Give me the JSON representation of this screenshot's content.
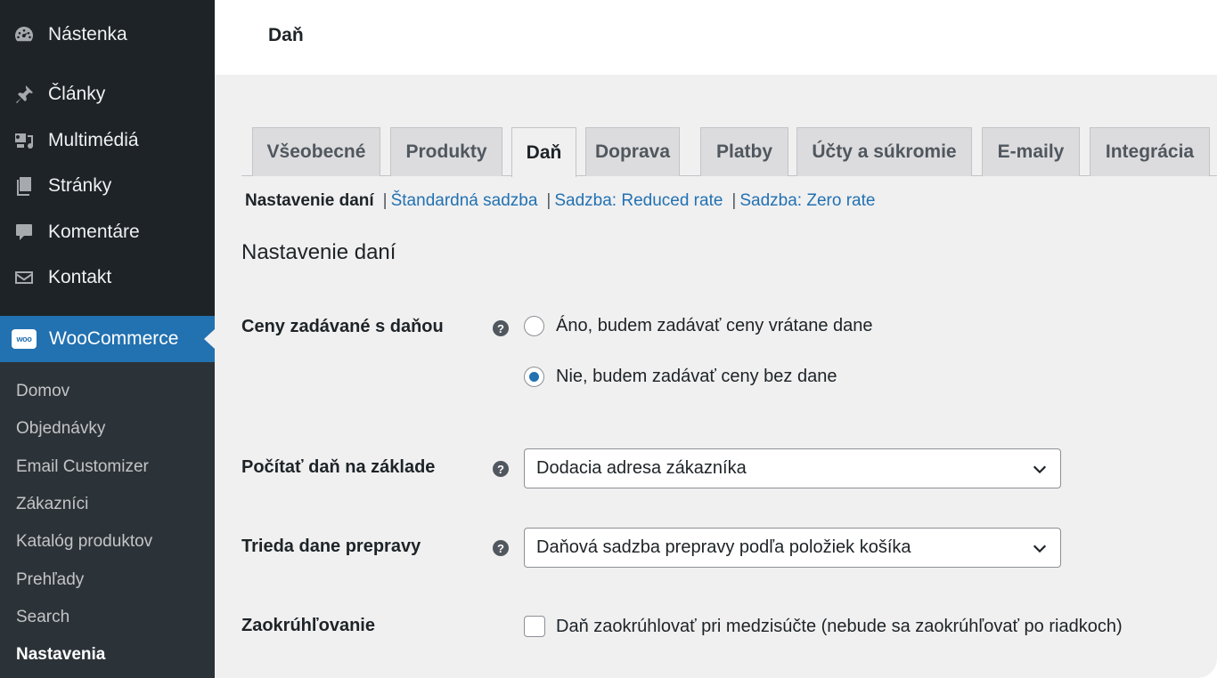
{
  "sidebar": {
    "menu": [
      {
        "label": "Nástenka",
        "icon": "dashboard-icon"
      },
      {
        "label": "Články",
        "icon": "pin-icon"
      },
      {
        "label": "Multimédiá",
        "icon": "media-icon"
      },
      {
        "label": "Stránky",
        "icon": "pages-icon"
      },
      {
        "label": "Komentáre",
        "icon": "comments-icon"
      },
      {
        "label": "Kontakt",
        "icon": "mail-icon"
      }
    ],
    "woocommerce": {
      "label": "WooCommerce",
      "logo_text": "woo"
    },
    "submenu": [
      {
        "label": "Domov"
      },
      {
        "label": "Objednávky"
      },
      {
        "label": "Email Customizer"
      },
      {
        "label": "Zákazníci"
      },
      {
        "label": "Katalóg produktov"
      },
      {
        "label": "Prehľady"
      },
      {
        "label": "Search"
      },
      {
        "label": "Nastavenia"
      }
    ]
  },
  "header": {
    "title": "Daň"
  },
  "tabs": [
    {
      "label": "Všeobecné"
    },
    {
      "label": "Produkty"
    },
    {
      "label": "Daň",
      "active": true
    },
    {
      "label": "Doprava"
    },
    {
      "label": "Platby"
    },
    {
      "label": "Účty a súkromie"
    },
    {
      "label": "E-maily"
    },
    {
      "label": "Integrácia"
    }
  ],
  "subnav": {
    "current": "Nastavenie daní",
    "links": [
      "Štandardná sadzba",
      "Sadzba: Reduced rate",
      "Sadzba: Zero rate"
    ],
    "separator": "|"
  },
  "section_title": "Nastavenie daní",
  "form": {
    "prices_entered": {
      "label": "Ceny zadávané s daňou",
      "help": "?",
      "options": [
        {
          "label": "Áno, budem zadávať ceny vrátane dane",
          "checked": false
        },
        {
          "label": "Nie, budem zadávať ceny bez dane",
          "checked": true
        }
      ]
    },
    "calc_based_on": {
      "label": "Počítať daň na základe",
      "help": "?",
      "value": "Dodacia adresa zákazníka"
    },
    "shipping_tax_class": {
      "label": "Trieda dane prepravy",
      "help": "?",
      "value": "Daňová sadzba prepravy podľa položiek košíka"
    },
    "rounding": {
      "label": "Zaokrúhľovanie",
      "checkbox_label": "Daň zaokrúhlovať pri medzisúčte (nebude sa zaokrúhľovať po riadkoch)",
      "checked": false
    }
  },
  "colors": {
    "accent": "#2271b1",
    "sidebar_bg": "#1d2327",
    "submenu_bg": "#2c3338",
    "content_bg": "#f0f0f1"
  }
}
